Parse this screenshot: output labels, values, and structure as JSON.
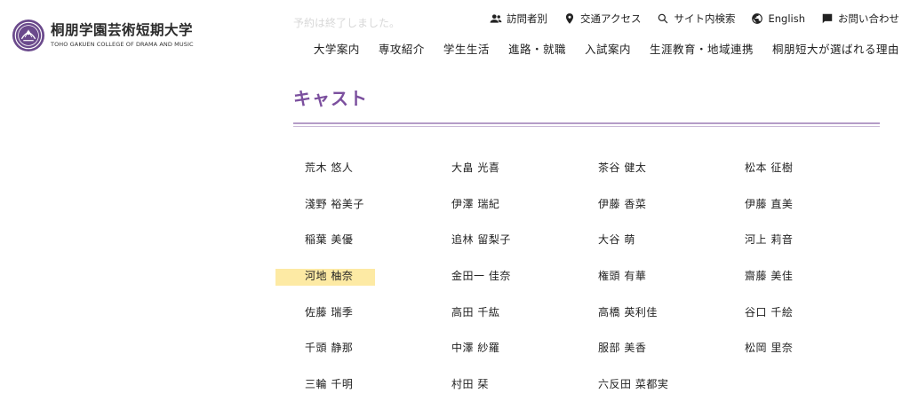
{
  "logo": {
    "name": "桐朋学園芸術短期大学",
    "subtitle": "TOHO GAKUEN COLLEGE OF DRAMA AND MUSIC"
  },
  "notice": "予約は終了しました。",
  "utility": [
    {
      "label": "訪問者別",
      "icon": "users-icon"
    },
    {
      "label": "交通アクセス",
      "icon": "map-pin-icon"
    },
    {
      "label": "サイト内検索",
      "icon": "search-icon"
    },
    {
      "label": "English",
      "icon": "globe-icon"
    },
    {
      "label": "お問い合わせ",
      "icon": "chat-icon"
    }
  ],
  "nav": [
    "大学案内",
    "専攻紹介",
    "学生生活",
    "進路・就職",
    "入試案内",
    "生涯教育・地域連携",
    "桐朋短大が選ばれる理由"
  ],
  "heading": "キャスト",
  "accent_color": "#7b4f9e",
  "cast": [
    [
      "荒木 悠人",
      "大畠 光喜",
      "茶谷 健太",
      "松本 征樹"
    ],
    [
      "淺野 裕美子",
      "伊澤 瑞紀",
      "伊藤 香菜",
      "伊藤 直美"
    ],
    [
      "稲葉 美優",
      "追林 留梨子",
      "大谷 萌",
      "河上 莉音"
    ],
    [
      "河地 柚奈",
      "金田一 佳奈",
      "権頭 有華",
      "齋藤 美佳"
    ],
    [
      "佐藤 瑞季",
      "高田 千紘",
      "高橋 英利佳",
      "谷口 千絵"
    ],
    [
      "千頭 静那",
      "中澤 紗羅",
      "服部 美香",
      "松岡 里奈"
    ],
    [
      "三輪 千明",
      "村田 栞",
      "六反田 菜都実",
      ""
    ]
  ]
}
